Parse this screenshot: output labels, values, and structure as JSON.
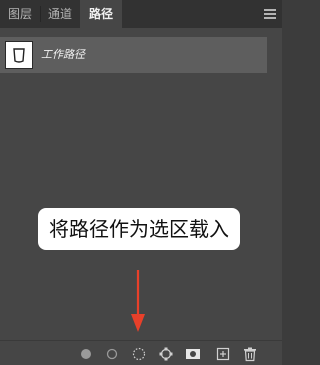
{
  "tabs": [
    {
      "label": "图层"
    },
    {
      "label": "通道"
    },
    {
      "label": "路径",
      "active": true
    }
  ],
  "paths": [
    {
      "name": "工作路径",
      "selected": true
    }
  ],
  "callout": {
    "text": "将路径作为选区载入"
  },
  "bottom_buttons": [
    {
      "icon": "fill-path-icon"
    },
    {
      "icon": "stroke-path-icon"
    },
    {
      "icon": "load-as-selection-icon"
    },
    {
      "icon": "make-work-path-icon"
    },
    {
      "icon": "add-mask-icon"
    },
    {
      "icon": "new-path-icon"
    },
    {
      "icon": "delete-path-icon"
    }
  ],
  "colors": {
    "panel_bg": "#464646",
    "tabbar_bg": "#323232",
    "selected_row": "#5e5e5e",
    "arrow": "#e8402a"
  }
}
